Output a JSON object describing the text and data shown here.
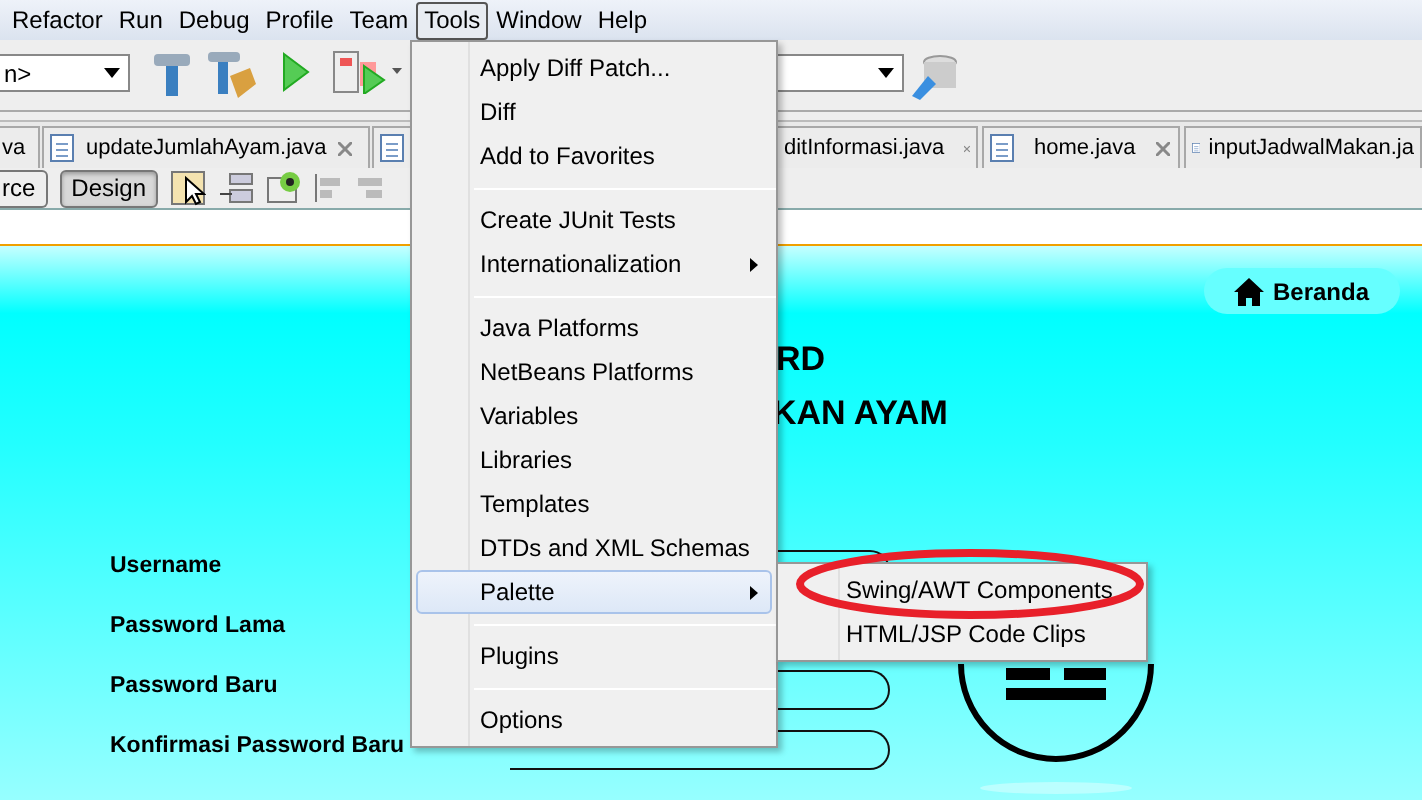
{
  "menubar": [
    {
      "label": "Refactor",
      "selected": false
    },
    {
      "label": "Run",
      "selected": false
    },
    {
      "label": "Debug",
      "selected": false
    },
    {
      "label": "Profile",
      "selected": false
    },
    {
      "label": "Team",
      "selected": false
    },
    {
      "label": "Tools",
      "selected": true
    },
    {
      "label": "Window",
      "selected": false
    },
    {
      "label": "Help",
      "selected": false
    }
  ],
  "toolbar": {
    "config_combo": {
      "value": "n>"
    }
  },
  "editor_tabs": [
    {
      "label": "va"
    },
    {
      "label": "updateJumlahAyam.java"
    },
    {
      "label": "ditInformasi.java"
    },
    {
      "label": "home.java"
    },
    {
      "label": "inputJadwalMakan.ja"
    }
  ],
  "view_buttons": [
    {
      "label": "rce",
      "selected": false
    },
    {
      "label": "Design",
      "selected": true
    }
  ],
  "form": {
    "title_lines": [
      "RD",
      "KAN AYAM"
    ],
    "home_button": "Beranda",
    "fields": [
      {
        "label": "Username"
      },
      {
        "label": "Password Lama"
      },
      {
        "label": "Password Baru"
      },
      {
        "label": "Konfirmasi Password Baru"
      }
    ]
  },
  "tools_menu": {
    "sections": [
      [
        {
          "label": "Apply Diff Patch...",
          "submenu": false,
          "selected": false
        },
        {
          "label": "Diff",
          "submenu": false,
          "selected": false
        },
        {
          "label": "Add to Favorites",
          "submenu": false,
          "selected": false
        }
      ],
      [
        {
          "label": "Create JUnit Tests",
          "submenu": false,
          "selected": false
        },
        {
          "label": "Internationalization",
          "submenu": true,
          "selected": false
        }
      ],
      [
        {
          "label": "Java Platforms",
          "submenu": false,
          "selected": false
        },
        {
          "label": "NetBeans Platforms",
          "submenu": false,
          "selected": false
        },
        {
          "label": "Variables",
          "submenu": false,
          "selected": false
        },
        {
          "label": "Libraries",
          "submenu": false,
          "selected": false
        },
        {
          "label": "Templates",
          "submenu": false,
          "selected": false
        },
        {
          "label": "DTDs and XML Schemas",
          "submenu": false,
          "selected": false
        },
        {
          "label": "Palette",
          "submenu": true,
          "selected": true
        }
      ],
      [
        {
          "label": "Plugins",
          "submenu": false,
          "selected": false
        }
      ],
      [
        {
          "label": "Options",
          "submenu": false,
          "selected": false
        }
      ]
    ]
  },
  "palette_submenu": [
    {
      "label": "Swing/AWT Components",
      "circled": true
    },
    {
      "label": "HTML/JSP Code Clips",
      "circled": false
    }
  ]
}
